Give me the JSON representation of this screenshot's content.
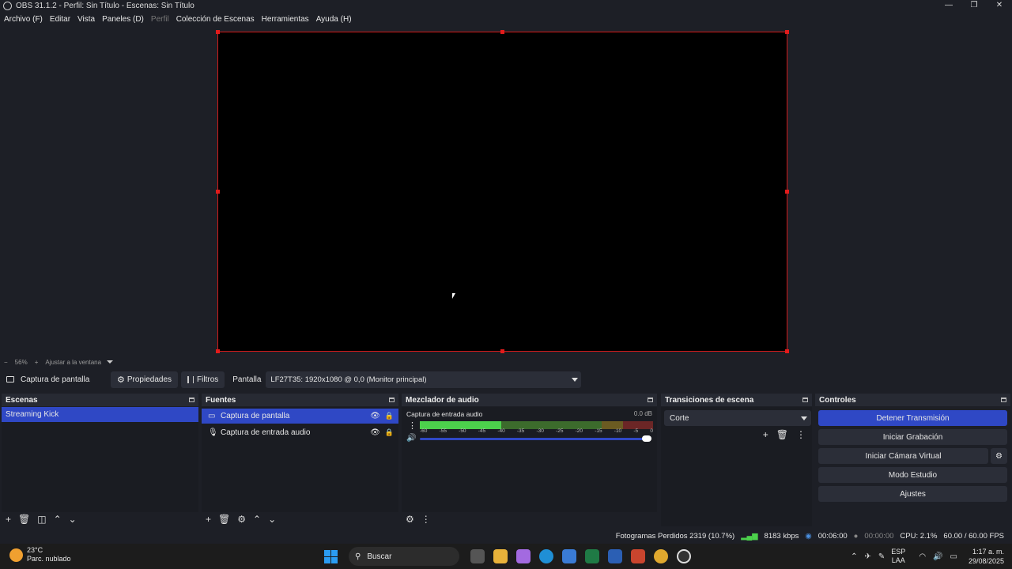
{
  "window": {
    "title": "OBS 31.1.2 - Perfil: Sin Título - Escenas: Sin Título"
  },
  "menu": [
    "Archivo (F)",
    "Editar",
    "Vista",
    "Paneles (D)",
    "Perfil",
    "Colección de Escenas",
    "Herramientas",
    "Ayuda (H)"
  ],
  "zoom": {
    "minus": "−",
    "value": "56%",
    "plus": "+",
    "fit": "Ajustar a la ventana"
  },
  "context": {
    "source": "Captura de pantalla",
    "properties": "Propiedades",
    "filters": "Filtros",
    "display_label": "Pantalla",
    "display_value": "LF27T35: 1920x1080 @ 0,0 (Monitor principal)"
  },
  "scenes": {
    "title": "Escenas",
    "items": [
      "Streaming Kick"
    ]
  },
  "sources": {
    "title": "Fuentes",
    "items": [
      "Captura de pantalla",
      "Captura de entrada audio"
    ]
  },
  "mixer": {
    "title": "Mezclador de audio",
    "channel": "Captura de entrada audio",
    "db": "0.0 dB",
    "scale": [
      "-60",
      "-55",
      "-50",
      "-45",
      "-40",
      "-35",
      "-30",
      "-25",
      "-20",
      "-15",
      "-10",
      "-5",
      "0"
    ],
    "volume_fraction": 1.0
  },
  "transitions": {
    "title": "Transiciones de escena",
    "selected": "Corte"
  },
  "controls": {
    "title": "Controles",
    "stop_stream": "Detener Transmisión",
    "start_recording": "Iniciar Grabación",
    "start_virtual_cam": "Iniciar Cámara Virtual",
    "studio_mode": "Modo Estudio",
    "settings": "Ajustes"
  },
  "status": {
    "dropped": "Fotogramas Perdidos 2319 (10.7%)",
    "bitrate": "8183 kbps",
    "stream_time": "00:06:00",
    "rec_time": "00:00:00",
    "cpu": "CPU: 2.1%",
    "fps": "60.00 / 60.00 FPS"
  },
  "taskbar": {
    "temp": "23°C",
    "weather": "Parc. nublado",
    "search": "Buscar",
    "lang1": "ESP",
    "lang2": "LAA",
    "time": "1:17 a. m.",
    "date": "29/08/2025"
  }
}
